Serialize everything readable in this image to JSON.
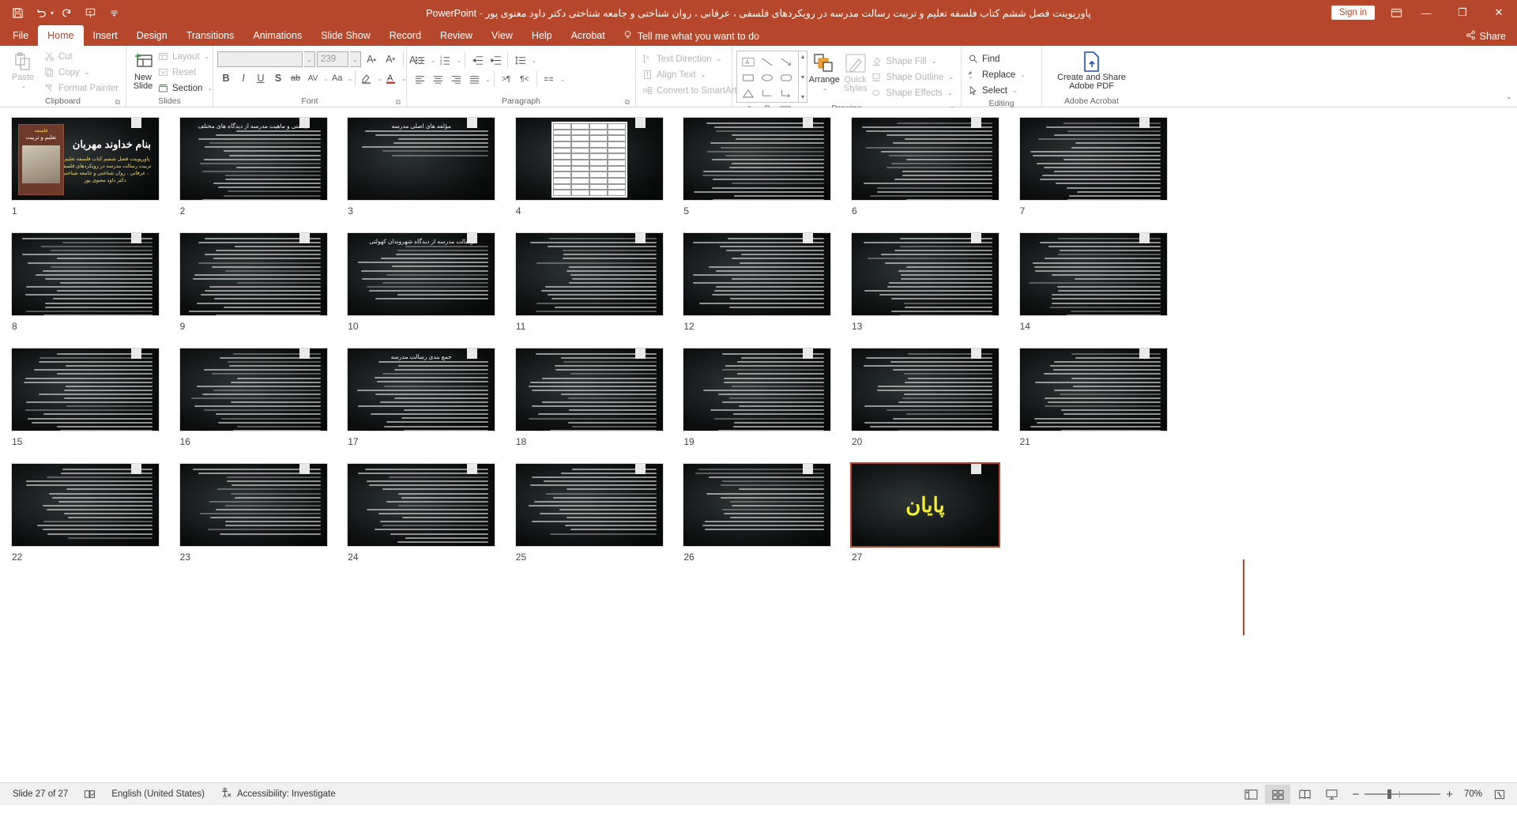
{
  "window": {
    "title": "پاورپوینت فصل ششم کتاب فلسفه تعلیم و تربیت رسالت مدرسه در رویکردهای فلسفی ، عرفانی ، روان شناختی و جامعه شناختی دکتر داود معنوی پور  -  PowerPoint",
    "sign_in": "Sign in",
    "minimize": "—",
    "restore": "❐",
    "close": "✕",
    "ribbon_display_icon": "ribbon-display-options-icon"
  },
  "quick_access": [
    {
      "name": "save-icon",
      "label": "Save"
    },
    {
      "name": "undo-icon",
      "label": "Undo"
    },
    {
      "name": "redo-icon",
      "label": "Redo"
    },
    {
      "name": "start-presentation-icon",
      "label": "Start From Beginning"
    },
    {
      "name": "customize-qat-icon",
      "label": "Customize Quick Access Toolbar"
    }
  ],
  "tabs": [
    {
      "label": "File",
      "active": false
    },
    {
      "label": "Home",
      "active": true
    },
    {
      "label": "Insert",
      "active": false
    },
    {
      "label": "Design",
      "active": false
    },
    {
      "label": "Transitions",
      "active": false
    },
    {
      "label": "Animations",
      "active": false
    },
    {
      "label": "Slide Show",
      "active": false
    },
    {
      "label": "Record",
      "active": false
    },
    {
      "label": "Review",
      "active": false
    },
    {
      "label": "View",
      "active": false
    },
    {
      "label": "Help",
      "active": false
    },
    {
      "label": "Acrobat",
      "active": false
    }
  ],
  "tell_me": "Tell me what you want to do",
  "share": "Share",
  "ribbon": {
    "clipboard": {
      "label": "Clipboard",
      "paste": "Paste",
      "cut": "Cut",
      "copy": "Copy",
      "format_painter": "Format Painter"
    },
    "slides": {
      "label": "Slides",
      "new_slide_l1": "New",
      "new_slide_l2": "Slide",
      "layout": "Layout",
      "reset": "Reset",
      "section": "Section"
    },
    "font": {
      "label": "Font",
      "font_name": "",
      "font_size": "239",
      "bold": "B",
      "italic": "I",
      "underline": "U",
      "shadow": "S",
      "strikethrough": "ab",
      "char_spacing": "AV",
      "change_case": "Aa"
    },
    "paragraph": {
      "label": "Paragraph",
      "text_direction": "Text Direction",
      "align_text": "Align Text",
      "convert_to_smartart": "Convert to SmartArt"
    },
    "drawing": {
      "label": "Drawing",
      "arrange": "Arrange",
      "quick_styles_l1": "Quick",
      "quick_styles_l2": "Styles",
      "shape_fill": "Shape Fill",
      "shape_outline": "Shape Outline",
      "shape_effects": "Shape Effects"
    },
    "editing": {
      "label": "Editing",
      "find": "Find",
      "replace": "Replace",
      "select": "Select"
    },
    "adobe": {
      "label": "Adobe Acrobat",
      "create_share_l1": "Create and Share",
      "create_share_l2": "Adobe PDF"
    }
  },
  "status": {
    "slide_counter": "Slide 27 of 27",
    "notes_icon": "notes-icon",
    "language": "English (United States)",
    "accessibility_icon": "accessibility-icon",
    "accessibility": "Accessibility: Investigate",
    "zoom_level": "70%",
    "zoom_minus": "−",
    "zoom_plus": "+",
    "views": [
      {
        "name": "normal-view-button",
        "label": "Normal",
        "active": false
      },
      {
        "name": "slide-sorter-view-button",
        "label": "Slide Sorter",
        "active": true
      },
      {
        "name": "reading-view-button",
        "label": "Reading View",
        "active": false
      },
      {
        "name": "slide-show-button",
        "label": "Slide Show",
        "active": false
      }
    ],
    "fit_slide_icon": "fit-slide-to-window-icon"
  },
  "slides": [
    {
      "number": "1",
      "kind": "title",
      "title": "بنام خداوند مهربان",
      "subtitle": "پاورپوینت فصل ششم کتاب فلسفه تعلیم و تربیت رسالت مدرسه در رویکردهای فلسفی ، عرفانی ، روان شناختی و جامعه شناختی دکتر داود معنوی پور",
      "selected": false
    },
    {
      "number": "2",
      "kind": "text",
      "title": "چیستی و ماهیت مدرسه از دیدگاه های مختلف",
      "lines": 22,
      "selected": false
    },
    {
      "number": "3",
      "kind": "bullets",
      "title": "مؤلفه های اصلی مدرسه",
      "lines": 7,
      "selected": false
    },
    {
      "number": "4",
      "kind": "table",
      "title": "",
      "selected": false
    },
    {
      "number": "5",
      "kind": "text",
      "title": "",
      "lines": 20,
      "selected": false
    },
    {
      "number": "6",
      "kind": "text",
      "title": "",
      "lines": 22,
      "selected": false
    },
    {
      "number": "7",
      "kind": "text",
      "title": "",
      "lines": 21,
      "selected": false
    },
    {
      "number": "8",
      "kind": "text",
      "title": "",
      "lines": 22,
      "selected": false
    },
    {
      "number": "9",
      "kind": "text",
      "title": "",
      "lines": 20,
      "selected": false
    },
    {
      "number": "10",
      "kind": "text",
      "title": "رسالت مدرسه از دیدگاه شهروندان کهولتی",
      "lines": 14,
      "selected": false
    },
    {
      "number": "11",
      "kind": "text",
      "title": "",
      "lines": 19,
      "selected": false
    },
    {
      "number": "12",
      "kind": "text",
      "title": "",
      "lines": 18,
      "selected": false
    },
    {
      "number": "13",
      "kind": "text",
      "title": "",
      "lines": 20,
      "selected": false
    },
    {
      "number": "14",
      "kind": "text",
      "title": "",
      "lines": 21,
      "selected": false
    },
    {
      "number": "15",
      "kind": "text",
      "title": "",
      "lines": 21,
      "selected": false
    },
    {
      "number": "16",
      "kind": "text",
      "title": "",
      "lines": 20,
      "selected": false
    },
    {
      "number": "17",
      "kind": "text",
      "title": "جمع بندی رسالت مدرسه",
      "lines": 18,
      "selected": false
    },
    {
      "number": "18",
      "kind": "text",
      "title": "",
      "lines": 21,
      "selected": false
    },
    {
      "number": "19",
      "kind": "text",
      "title": "",
      "lines": 21,
      "selected": false
    },
    {
      "number": "20",
      "kind": "text",
      "title": "",
      "lines": 22,
      "selected": false
    },
    {
      "number": "21",
      "kind": "text",
      "title": "",
      "lines": 20,
      "selected": false
    },
    {
      "number": "22",
      "kind": "text",
      "title": "",
      "lines": 18,
      "selected": false
    },
    {
      "number": "23",
      "kind": "text",
      "title": "",
      "lines": 17,
      "selected": false
    },
    {
      "number": "24",
      "kind": "text",
      "title": "",
      "lines": 19,
      "selected": false
    },
    {
      "number": "25",
      "kind": "text",
      "title": "",
      "lines": 17,
      "selected": false
    },
    {
      "number": "26",
      "kind": "text",
      "title": "",
      "lines": 16,
      "selected": false
    },
    {
      "number": "27",
      "kind": "end",
      "title": "پایان",
      "selected": true
    }
  ],
  "colors": {
    "accent": "#b7472a",
    "ribbon_bg": "#ffffff",
    "canvas_bg": "#ffffff",
    "thumb_bg": "#151515",
    "end_text": "#f5f02a"
  }
}
